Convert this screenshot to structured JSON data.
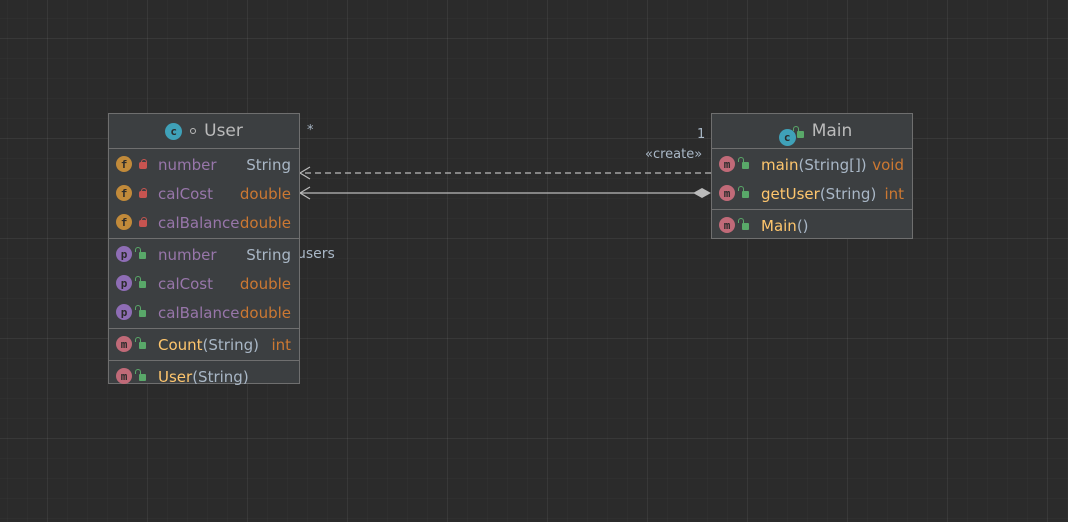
{
  "user_class": {
    "title": "User",
    "class_icon": "class-icon",
    "private_fields": [
      {
        "name": "number",
        "type": "String"
      },
      {
        "name": "calCost",
        "type": "double"
      },
      {
        "name": "calBalance",
        "type": "double"
      }
    ],
    "properties": [
      {
        "name": "number",
        "type": "String"
      },
      {
        "name": "calCost",
        "type": "double"
      },
      {
        "name": "calBalance",
        "type": "double"
      }
    ],
    "methods": [
      {
        "name": "Count",
        "args": "(String)",
        "type": "int"
      }
    ],
    "constructors": [
      {
        "name": "User",
        "args": "(String)"
      }
    ]
  },
  "main_class": {
    "title": "Main",
    "class_icon": "main-class-icon",
    "methods": [
      {
        "name": "main",
        "args": "(String[])",
        "type": "void"
      },
      {
        "name": "getUser",
        "args": "(String)",
        "type": "int"
      }
    ],
    "constructors": [
      {
        "name": "Main",
        "args": "()"
      }
    ]
  },
  "icon_letters": {
    "field": "f",
    "property": "p",
    "method": "m",
    "class": "c"
  },
  "edges": {
    "create_label": "«create»",
    "multiplicity_user": "*",
    "multiplicity_main": "1",
    "role_label": "users"
  },
  "colors": {
    "background": "#2b2b2b",
    "box": "#3c3f41",
    "field": "#9876aa",
    "method": "#ffc66d",
    "keyword": "#cc7832"
  }
}
